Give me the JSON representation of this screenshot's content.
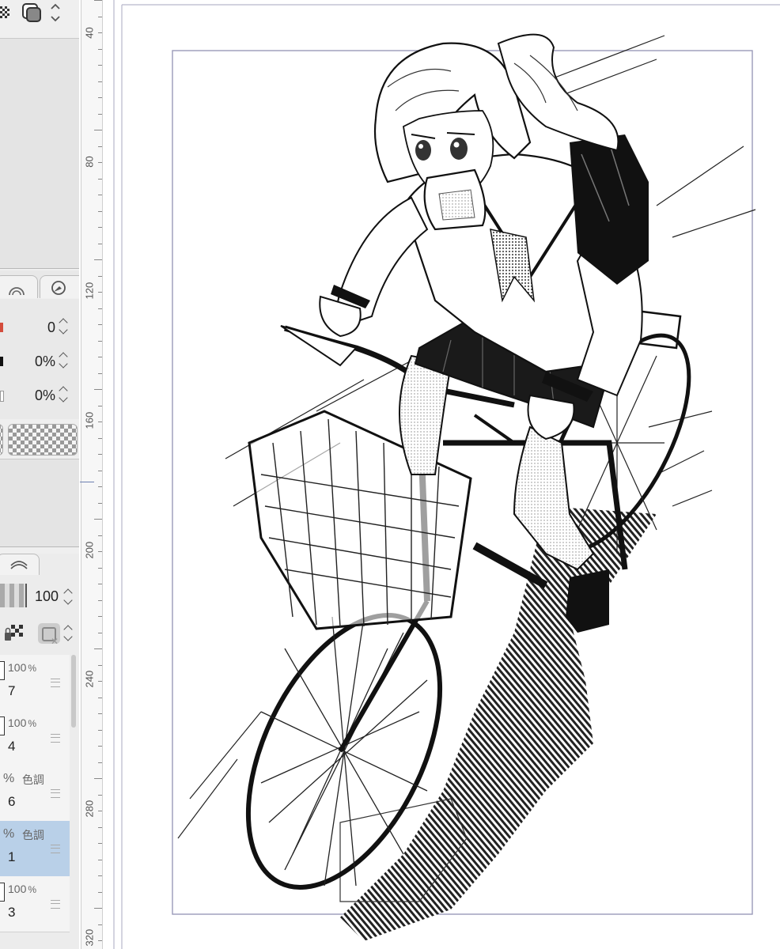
{
  "app": {
    "accent_selected": "#b9d0e8",
    "panel_bg": "#efefef"
  },
  "top_toolbar": {
    "icons": [
      "pattern-grid-icon",
      "layer-copy-icon",
      "scroll-up-down-icon"
    ]
  },
  "tool_property": {
    "tab_icons": [
      "wheel-icon",
      "pen-pressure-icon"
    ],
    "rows": [
      {
        "value": "0",
        "marker_color": "#d44c3c"
      },
      {
        "value": "0%",
        "marker_color": "#111111"
      },
      {
        "value": "0%",
        "marker_color": "#ffffff"
      }
    ]
  },
  "layer_panel": {
    "opacity_value": "100",
    "layers": [
      {
        "opacity": "100",
        "mode": "",
        "name": "7",
        "selected": false
      },
      {
        "opacity": "100",
        "mode": "",
        "name": "4",
        "selected": false
      },
      {
        "opacity": "",
        "mode": "色調",
        "name": "6",
        "selected": false
      },
      {
        "opacity": "",
        "mode": "色調",
        "name": "1",
        "selected": true
      },
      {
        "opacity": "100",
        "mode": "",
        "name": "3",
        "selected": false
      }
    ],
    "percent_sign": "%"
  },
  "ruler": {
    "labels": [
      "40",
      "80",
      "120",
      "160",
      "200",
      "240",
      "280",
      "320"
    ]
  },
  "canvas": {
    "description_icon": "manga-illustration-girl-on-bicycle"
  }
}
